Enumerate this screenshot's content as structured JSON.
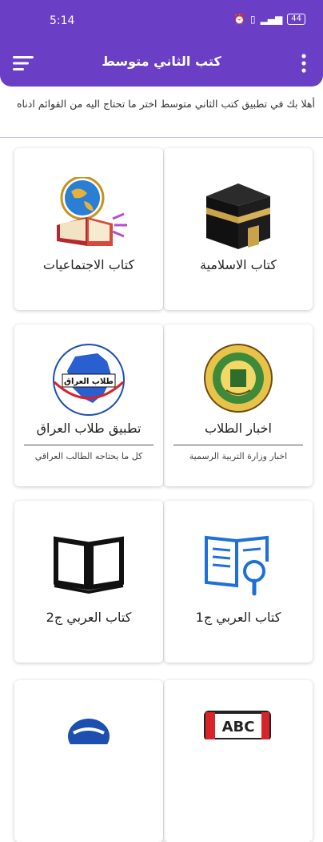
{
  "status_bar": {
    "time": "5:14",
    "battery": "44"
  },
  "app_bar": {
    "title": "كتب الثاني متوسط"
  },
  "welcome_text": "أهلا بك في تطبيق كتب الثاني متوسط اختر ما تحتاج اليه من القوائم ادناه",
  "cards": [
    {
      "label": "كتاب الاسلامية",
      "icon": "kaaba-icon"
    },
    {
      "label": "كتاب الاجتماعيات",
      "icon": "globe-book-icon"
    },
    {
      "label": "اخبار الطلاب",
      "subtitle": "اخبار وزارة التربية الرسمية",
      "icon": "ministry-seal-icon"
    },
    {
      "label": "تطبيق طلاب العراق",
      "subtitle": "كل ما يحتاجه الطالب العراقي",
      "icon": "iraq-map-icon",
      "logo_text": "طلاب العراق"
    },
    {
      "label": "كتاب العربي ج1",
      "icon": "book-search-icon"
    },
    {
      "label": "كتاب العربي ج2",
      "icon": "open-book-icon"
    },
    {
      "label": "",
      "icon": "abc-book-icon",
      "logo_text": "ABC"
    },
    {
      "label": "",
      "icon": "globe-icon"
    }
  ],
  "colors": {
    "primary": "#6a3fc6",
    "card_bg": "#ffffff",
    "text": "#222222"
  }
}
